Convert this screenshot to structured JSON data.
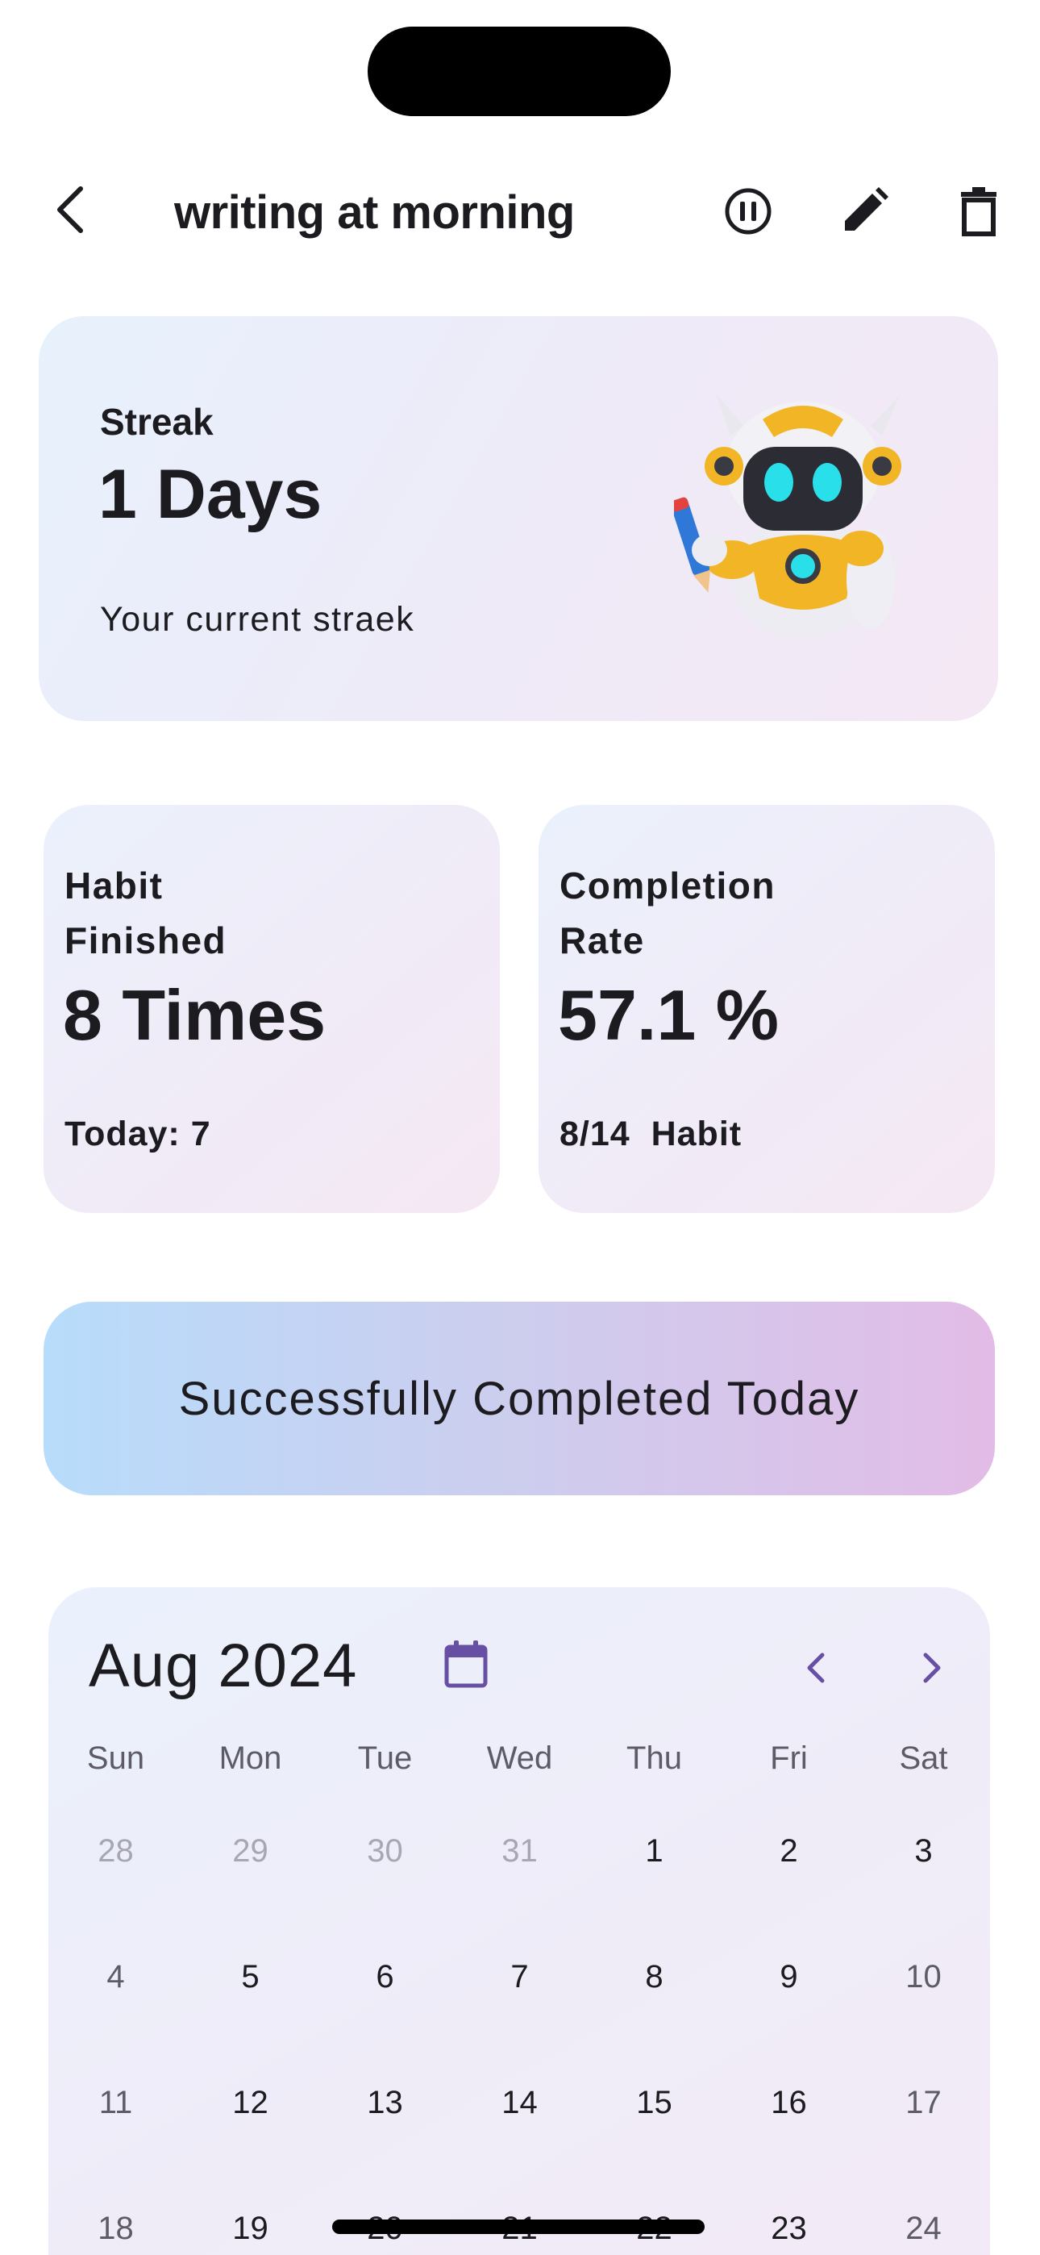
{
  "app_bar": {
    "title": "writing at morning",
    "back_icon": "chevron-left-icon",
    "pause_icon": "pause-circle-icon",
    "edit_icon": "pencil-icon",
    "delete_icon": "trash-icon"
  },
  "streak": {
    "label": "Streak",
    "value": "1 Days",
    "subtitle": "Your current straek",
    "illustration": "robot-holding-pencil"
  },
  "stats": {
    "habit_finished": {
      "label": "Habit Finished",
      "value": "8 Times",
      "footer": "Today: 7"
    },
    "completion_rate": {
      "label": "Completion Rate",
      "value": "57.1 %",
      "footer": "8/14  Habit"
    }
  },
  "completed_banner": {
    "text": "Successfully Completed Today"
  },
  "calendar": {
    "month_label": "Aug 2024",
    "calendar_icon": "calendar-icon",
    "prev_icon": "chevron-left-icon",
    "next_icon": "chevron-right-icon",
    "weekdays": [
      "Sun",
      "Mon",
      "Tue",
      "Wed",
      "Thu",
      "Fri",
      "Sat"
    ],
    "weeks": [
      [
        "28",
        "29",
        "30",
        "31",
        "1",
        "2",
        "3"
      ],
      [
        "4",
        "5",
        "6",
        "7",
        "8",
        "9",
        "10"
      ],
      [
        "11",
        "12",
        "13",
        "14",
        "15",
        "16",
        "17"
      ],
      [
        "18",
        "19",
        "20",
        "21",
        "22",
        "23",
        "24"
      ]
    ]
  },
  "colors": {
    "accent": "#6750a4",
    "text": "#1c1b1f",
    "muted_text": "#a8a6b0",
    "banner_start": "#b8dcfb",
    "banner_end": "#e2bce6"
  }
}
